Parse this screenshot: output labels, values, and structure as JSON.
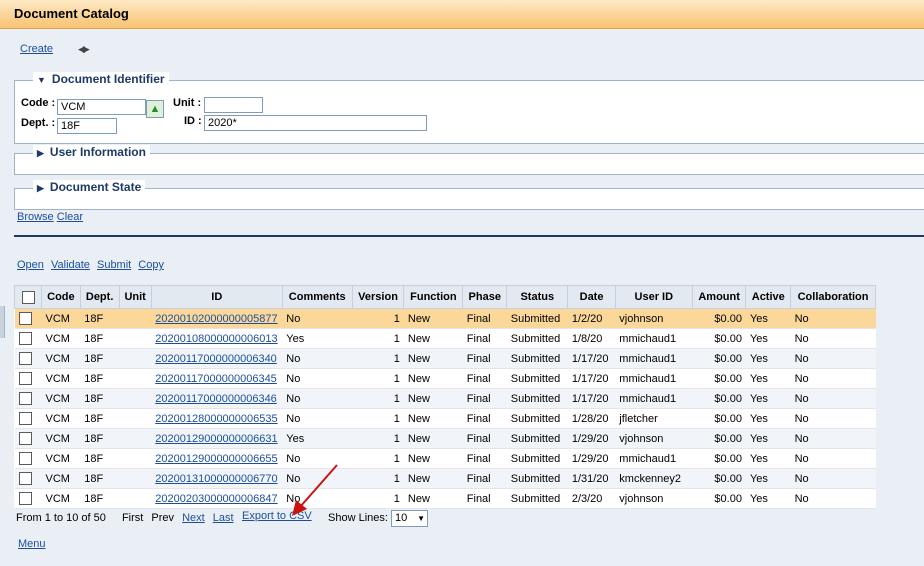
{
  "window": {
    "title": "Document Catalog"
  },
  "toolbar": {
    "create_label": "Create"
  },
  "doc_identifier": {
    "title": "Document Identifier",
    "code_label": "Code :",
    "code_value": "VCM",
    "unit_label": "Unit :",
    "unit_value": "",
    "dept_label": "Dept. :",
    "dept_value": "18F",
    "id_label": "ID :",
    "id_value": "2020*"
  },
  "user_info": {
    "title": "User Information"
  },
  "doc_state": {
    "title": "Document State"
  },
  "search_actions": {
    "browse": "Browse",
    "clear": "Clear"
  },
  "actions": {
    "open": "Open",
    "validate": "Validate",
    "submit": "Submit",
    "copy": "Copy"
  },
  "table": {
    "columns": [
      "Code",
      "Dept.",
      "Unit",
      "ID",
      "Comments",
      "Version",
      "Function",
      "Phase",
      "Status",
      "Date",
      "User ID",
      "Amount",
      "Active",
      "Collaboration"
    ],
    "rows": [
      {
        "code": "VCM",
        "dept": "18F",
        "unit": "",
        "id": "20200102000000005877",
        "comments": "No",
        "version": "1",
        "function": "New",
        "phase": "Final",
        "status": "Submitted",
        "date": "1/2/20",
        "user": "vjohnson",
        "amount": "$0.00",
        "active": "Yes",
        "collab": "No"
      },
      {
        "code": "VCM",
        "dept": "18F",
        "unit": "",
        "id": "20200108000000006013",
        "comments": "Yes",
        "version": "1",
        "function": "New",
        "phase": "Final",
        "status": "Submitted",
        "date": "1/8/20",
        "user": "mmichaud1",
        "amount": "$0.00",
        "active": "Yes",
        "collab": "No"
      },
      {
        "code": "VCM",
        "dept": "18F",
        "unit": "",
        "id": "20200117000000006340",
        "comments": "No",
        "version": "1",
        "function": "New",
        "phase": "Final",
        "status": "Submitted",
        "date": "1/17/20",
        "user": "mmichaud1",
        "amount": "$0.00",
        "active": "Yes",
        "collab": "No"
      },
      {
        "code": "VCM",
        "dept": "18F",
        "unit": "",
        "id": "20200117000000006345",
        "comments": "No",
        "version": "1",
        "function": "New",
        "phase": "Final",
        "status": "Submitted",
        "date": "1/17/20",
        "user": "mmichaud1",
        "amount": "$0.00",
        "active": "Yes",
        "collab": "No"
      },
      {
        "code": "VCM",
        "dept": "18F",
        "unit": "",
        "id": "20200117000000006346",
        "comments": "No",
        "version": "1",
        "function": "New",
        "phase": "Final",
        "status": "Submitted",
        "date": "1/17/20",
        "user": "mmichaud1",
        "amount": "$0.00",
        "active": "Yes",
        "collab": "No"
      },
      {
        "code": "VCM",
        "dept": "18F",
        "unit": "",
        "id": "20200128000000006535",
        "comments": "No",
        "version": "1",
        "function": "New",
        "phase": "Final",
        "status": "Submitted",
        "date": "1/28/20",
        "user": "jfletcher",
        "amount": "$0.00",
        "active": "Yes",
        "collab": "No"
      },
      {
        "code": "VCM",
        "dept": "18F",
        "unit": "",
        "id": "20200129000000006631",
        "comments": "Yes",
        "version": "1",
        "function": "New",
        "phase": "Final",
        "status": "Submitted",
        "date": "1/29/20",
        "user": "vjohnson",
        "amount": "$0.00",
        "active": "Yes",
        "collab": "No"
      },
      {
        "code": "VCM",
        "dept": "18F",
        "unit": "",
        "id": "20200129000000006655",
        "comments": "No",
        "version": "1",
        "function": "New",
        "phase": "Final",
        "status": "Submitted",
        "date": "1/29/20",
        "user": "mmichaud1",
        "amount": "$0.00",
        "active": "Yes",
        "collab": "No"
      },
      {
        "code": "VCM",
        "dept": "18F",
        "unit": "",
        "id": "20200131000000006770",
        "comments": "No",
        "version": "1",
        "function": "New",
        "phase": "Final",
        "status": "Submitted",
        "date": "1/31/20",
        "user": "kmckenney2",
        "amount": "$0.00",
        "active": "Yes",
        "collab": "No"
      },
      {
        "code": "VCM",
        "dept": "18F",
        "unit": "",
        "id": "20200203000000006847",
        "comments": "No",
        "version": "1",
        "function": "New",
        "phase": "Final",
        "status": "Submitted",
        "date": "2/3/20",
        "user": "vjohnson",
        "amount": "$0.00",
        "active": "Yes",
        "collab": "No"
      }
    ]
  },
  "pager": {
    "range": "From 1 to 10 of 50",
    "first": "First",
    "prev": "Prev",
    "next": "Next",
    "last": "Last",
    "export": "Export to CSV",
    "show_lines_label": "Show Lines:",
    "show_lines_value": "10"
  },
  "footer": {
    "menu": "Menu"
  },
  "colors": {
    "title_bar": "#f8c371",
    "link": "#1c4e9c",
    "selected_row": "#fbd89a",
    "annotation_arrow": "#cc1111"
  }
}
